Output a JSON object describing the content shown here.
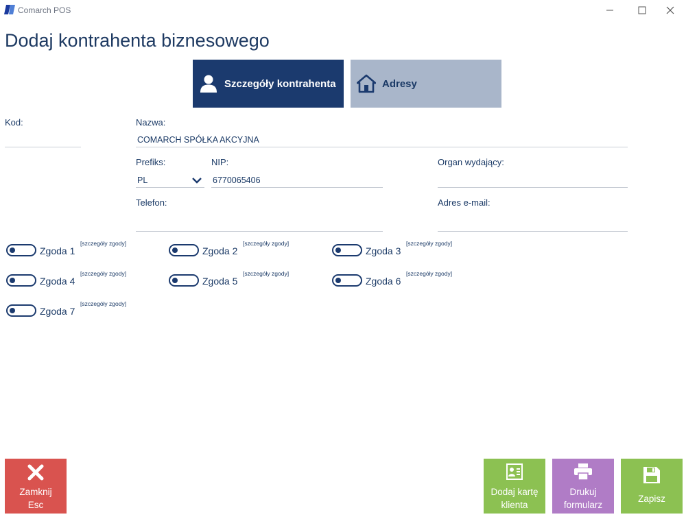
{
  "window": {
    "app_title": "Comarch POS",
    "minimize": "—",
    "maximize": "☐",
    "close": "✕"
  },
  "page": {
    "title": "Dodaj kontrahenta biznesowego"
  },
  "tabs": [
    {
      "label": "Szczegóły kontrahenta",
      "icon": "person-icon",
      "active": true
    },
    {
      "label": "Adresy",
      "icon": "house-icon",
      "active": false
    }
  ],
  "form": {
    "kod": {
      "label": "Kod:",
      "value": ""
    },
    "nazwa": {
      "label": "Nazwa:",
      "value": "COMARCH SPÓŁKA AKCYJNA"
    },
    "prefiks": {
      "label": "Prefiks:",
      "value": "PL"
    },
    "nip": {
      "label": "NIP:",
      "value": "6770065406"
    },
    "organ": {
      "label": "Organ wydający:",
      "value": ""
    },
    "telefon": {
      "label": "Telefon:",
      "value": ""
    },
    "email": {
      "label": "Adres e-mail:",
      "value": ""
    }
  },
  "consents": [
    {
      "label": "Zgoda 1",
      "details": "[szczegóły zgody]"
    },
    {
      "label": "Zgoda 2",
      "details": "[szczegóły zgody]"
    },
    {
      "label": "Zgoda 3",
      "details": "[szczegóły zgody]"
    },
    {
      "label": "Zgoda 4",
      "details": "[szczegóły zgody]"
    },
    {
      "label": "Zgoda 5",
      "details": "[szczegóły zgody]"
    },
    {
      "label": "Zgoda 6",
      "details": "[szczegóły zgody]"
    },
    {
      "label": "Zgoda 7",
      "details": "[szczegóły zgody]"
    }
  ],
  "buttons": {
    "close": {
      "line1": "Zamknij",
      "line2": "Esc",
      "color": "#d9534f"
    },
    "add_card": {
      "line1": "Dodaj kartę",
      "line2": "klienta",
      "color": "#8cc152"
    },
    "print": {
      "line1": "Drukuj",
      "line2": "formularz",
      "color": "#b07cc6"
    },
    "save": {
      "line1": "Zapisz",
      "color": "#8cc152"
    }
  },
  "colors": {
    "accent": "#1b3a6e",
    "tab_inactive": "#a9b6ca"
  }
}
